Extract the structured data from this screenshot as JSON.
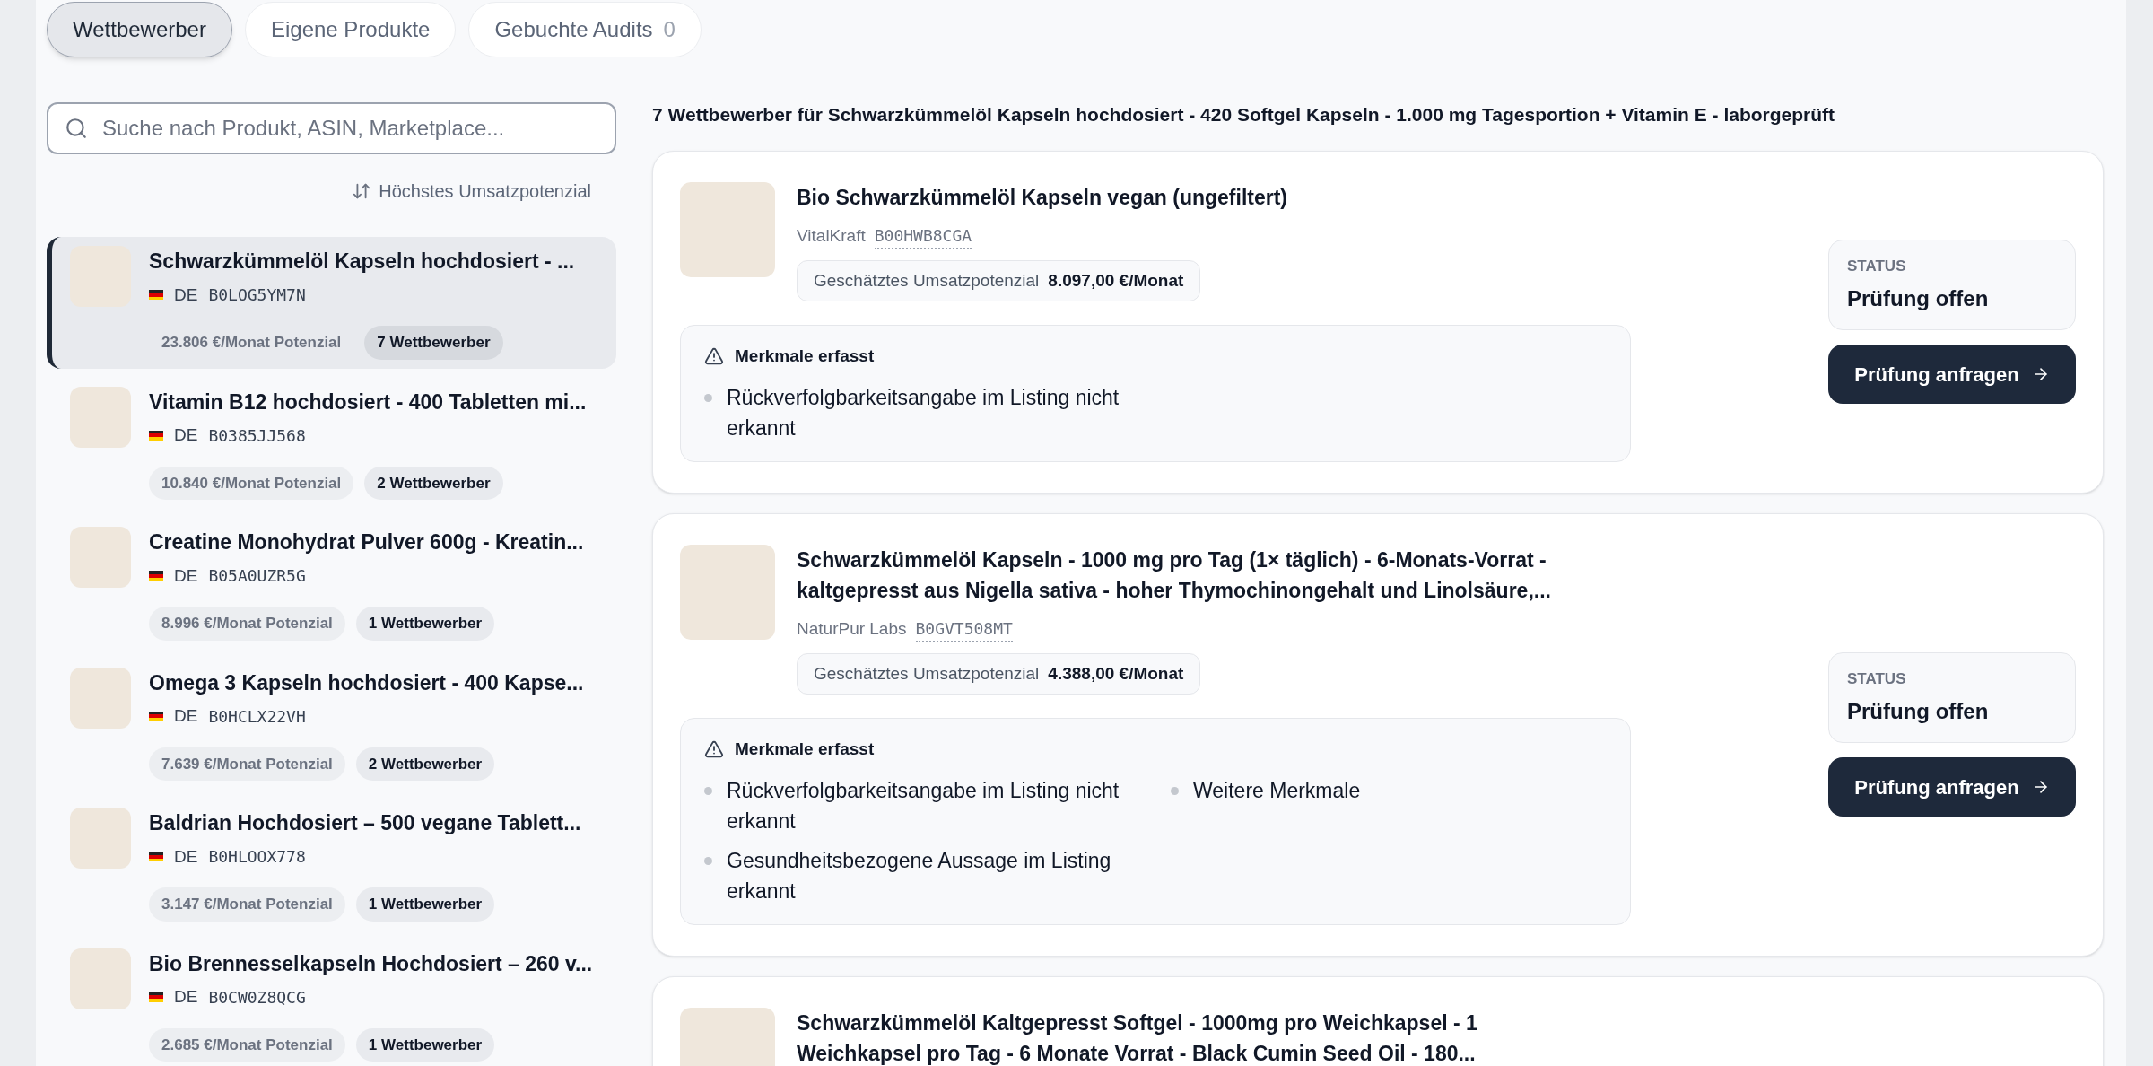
{
  "tabs": [
    {
      "label": "Wettbewerber",
      "selected": true
    },
    {
      "label": "Eigene Produkte",
      "selected": false
    },
    {
      "label": "Gebuchte Audits",
      "count": "0",
      "selected": false
    }
  ],
  "search": {
    "placeholder": "Suche nach Produkt, ASIN, Marketplace..."
  },
  "sort": {
    "label": "Höchstes Umsatzpotenzial"
  },
  "products": [
    {
      "title": "Schwarzkümmelöl Kapseln hochdosiert - ...",
      "country": "DE",
      "asin": "B0LOG5YM7N",
      "potential": "23.806 €/Monat Potenzial",
      "competitors": "7 Wettbewerber",
      "selected": true
    },
    {
      "title": "Vitamin B12 hochdosiert - 400 Tabletten mi...",
      "country": "DE",
      "asin": "B0385JJ568",
      "potential": "10.840 €/Monat Potenzial",
      "competitors": "2 Wettbewerber",
      "selected": false
    },
    {
      "title": "Creatine Monohydrat Pulver 600g - Kreatin...",
      "country": "DE",
      "asin": "B05A0UZR5G",
      "potential": "8.996 €/Monat Potenzial",
      "competitors": "1 Wettbewerber",
      "selected": false
    },
    {
      "title": "Omega 3 Kapseln hochdosiert - 400 Kapse...",
      "country": "DE",
      "asin": "B0HCLX22VH",
      "potential": "7.639 €/Monat Potenzial",
      "competitors": "2 Wettbewerber",
      "selected": false
    },
    {
      "title": "Baldrian Hochdosiert – 500 vegane Tablett...",
      "country": "DE",
      "asin": "B0HLOOX778",
      "potential": "3.147 €/Monat Potenzial",
      "competitors": "1 Wettbewerber",
      "selected": false
    },
    {
      "title": "Bio Brennesselkapseln Hochdosiert – 260 v...",
      "country": "DE",
      "asin": "B0CW0Z8QCG",
      "potential": "2.685 €/Monat Potenzial",
      "competitors": "1 Wettbewerber",
      "selected": false
    }
  ],
  "heading": "7 Wettbewerber für Schwarzkümmelöl Kapseln hochdosiert - 420 Softgel Kapseln - 1.000 mg Tagesportion + Vitamin E - laborgeprüft",
  "competitors": [
    {
      "title": "Bio Schwarzkümmelöl Kapseln vegan (ungefiltert)",
      "brand": "VitalKraft",
      "asin": "B00HWB8CGA",
      "potential_label": "Geschätztes Umsatzpotenzial",
      "potential_value": "8.097,00 €/Monat",
      "features_title": "Merkmale erfasst",
      "features": [
        "Rückverfolgbarkeitsangabe im Listing nicht erkannt"
      ],
      "status_label": "STATUS",
      "status": "Prüfung offen",
      "action": "Prüfung anfragen"
    },
    {
      "title": "Schwarzkümmelöl Kapseln - 1000 mg pro Tag (1× täglich) - 6-Monats-Vorrat - kaltgepresst aus Nigella sativa - hoher Thymochinongehalt und Linolsäure,...",
      "brand": "NaturPur Labs",
      "asin": "B0GVT508MT",
      "potential_label": "Geschätztes Umsatzpotenzial",
      "potential_value": "4.388,00 €/Monat",
      "features_title": "Merkmale erfasst",
      "features": [
        "Rückverfolgbarkeitsangabe im Listing nicht erkannt",
        "Weitere Merkmale",
        "Gesundheitsbezogene Aussage im Listing erkannt"
      ],
      "status_label": "STATUS",
      "status": "Prüfung offen",
      "action": "Prüfung anfragen"
    },
    {
      "title": "Schwarzkümmelöl Kaltgepresst Softgel - 1000mg pro Weichkapsel - 1 Weichkapsel pro Tag - 6 Monate Vorrat - Black Cumin Seed Oil - 180..."
    }
  ]
}
